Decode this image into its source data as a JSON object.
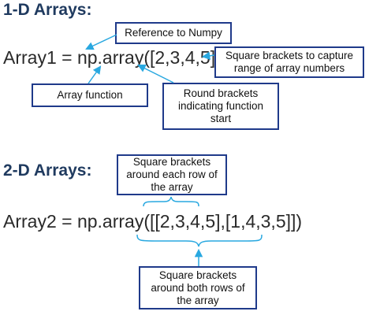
{
  "section1": {
    "heading": "1-D Arrays:",
    "code": "Array1 = np.array([2,3,4,5])",
    "callouts": {
      "numpy_reference": "Reference to Numpy",
      "square_brackets": "Square brackets to capture range of array numbers",
      "array_function": "Array function",
      "round_brackets": "Round brackets indicating function start"
    }
  },
  "section2": {
    "heading": "2-D Arrays:",
    "code": "Array2 = np.array([[2,3,4,5],[1,4,3,5]])",
    "callouts": {
      "each_row": "Square brackets around each row of the array",
      "both_rows": "Square brackets around both rows of the array"
    }
  },
  "colors": {
    "callout_border": "#1f3a8a",
    "arrow": "#29a8e0",
    "heading": "#1f3a5f"
  }
}
